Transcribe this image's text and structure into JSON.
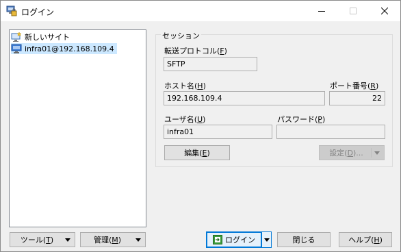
{
  "window": {
    "title": "ログイン"
  },
  "sites": [
    {
      "label": "新しいサイト",
      "icon": "new-site-icon"
    },
    {
      "label": "infra01@192.168.109.4",
      "icon": "computer-icon",
      "selected": true
    }
  ],
  "session": {
    "group_title": "セッション",
    "protocol": {
      "label": "転送プロトコル",
      "key": "F",
      "value": "SFTP"
    },
    "host": {
      "label": "ホスト名",
      "key": "H",
      "value": "192.168.109.4"
    },
    "port": {
      "label": "ポート番号",
      "key": "R",
      "value": "22"
    },
    "user": {
      "label": "ユーザ名",
      "key": "U",
      "value": "infra01"
    },
    "password": {
      "label": "パスワード",
      "key": "P",
      "value": ""
    },
    "edit": {
      "label": "編集",
      "key": "E"
    },
    "settings": {
      "label": "設定",
      "key": "D"
    }
  },
  "buttons": {
    "tools": {
      "label": "ツール",
      "key": "T"
    },
    "manage": {
      "label": "管理",
      "key": "M"
    },
    "login": {
      "label": "ログイン"
    },
    "close": {
      "label": "閉じる"
    },
    "help": {
      "label": "ヘルプ",
      "key": "H"
    }
  },
  "colors": {
    "selection": "#cce8ff",
    "focus_border": "#0078d7",
    "login_icon": "#3c9a3c"
  }
}
